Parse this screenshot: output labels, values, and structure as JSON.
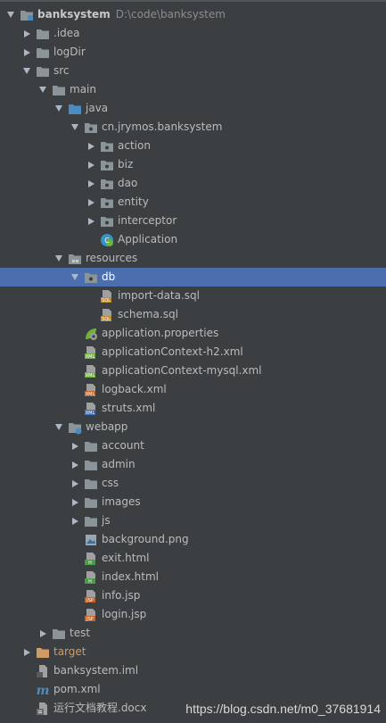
{
  "project": {
    "name": "banksystem",
    "path": "D:\\code\\banksystem"
  },
  "tree": [
    {
      "id": "banksystem",
      "label": "banksystem",
      "depth": 0,
      "arrow": "down",
      "icon": "module-folder-icon",
      "bold": true,
      "path": "D:\\code\\banksystem"
    },
    {
      "id": "idea",
      "label": ".idea",
      "depth": 1,
      "arrow": "right",
      "icon": "folder-icon"
    },
    {
      "id": "logdir",
      "label": "logDir",
      "depth": 1,
      "arrow": "right",
      "icon": "folder-icon"
    },
    {
      "id": "src",
      "label": "src",
      "depth": 1,
      "arrow": "down",
      "icon": "folder-icon"
    },
    {
      "id": "main",
      "label": "main",
      "depth": 2,
      "arrow": "down",
      "icon": "folder-icon"
    },
    {
      "id": "java",
      "label": "java",
      "depth": 3,
      "arrow": "down",
      "icon": "source-folder-icon"
    },
    {
      "id": "pkg",
      "label": "cn.jrymos.banksystem",
      "depth": 4,
      "arrow": "down",
      "icon": "package-icon"
    },
    {
      "id": "action",
      "label": "action",
      "depth": 5,
      "arrow": "right",
      "icon": "package-icon"
    },
    {
      "id": "biz",
      "label": "biz",
      "depth": 5,
      "arrow": "right",
      "icon": "package-icon"
    },
    {
      "id": "dao",
      "label": "dao",
      "depth": 5,
      "arrow": "right",
      "icon": "package-icon"
    },
    {
      "id": "entity",
      "label": "entity",
      "depth": 5,
      "arrow": "right",
      "icon": "package-icon"
    },
    {
      "id": "interceptor",
      "label": "interceptor",
      "depth": 5,
      "arrow": "right",
      "icon": "package-icon"
    },
    {
      "id": "application",
      "label": "Application",
      "depth": 5,
      "arrow": "none",
      "icon": "spring-boot-class-icon"
    },
    {
      "id": "resources",
      "label": "resources",
      "depth": 3,
      "arrow": "down",
      "icon": "resources-folder-icon"
    },
    {
      "id": "db",
      "label": "db",
      "depth": 4,
      "arrow": "down",
      "icon": "package-icon",
      "selected": true
    },
    {
      "id": "importdata",
      "label": "import-data.sql",
      "depth": 5,
      "arrow": "none",
      "icon": "sql-file-icon"
    },
    {
      "id": "schema",
      "label": "schema.sql",
      "depth": 5,
      "arrow": "none",
      "icon": "sql-file-icon"
    },
    {
      "id": "appprops",
      "label": "application.properties",
      "depth": 4,
      "arrow": "none",
      "icon": "spring-properties-icon"
    },
    {
      "id": "ctxh2",
      "label": "applicationContext-h2.xml",
      "depth": 4,
      "arrow": "none",
      "icon": "spring-xml-icon"
    },
    {
      "id": "ctxmysql",
      "label": "applicationContext-mysql.xml",
      "depth": 4,
      "arrow": "none",
      "icon": "spring-xml-icon"
    },
    {
      "id": "logback",
      "label": "logback.xml",
      "depth": 4,
      "arrow": "none",
      "icon": "xml-file-icon"
    },
    {
      "id": "struts",
      "label": "struts.xml",
      "depth": 4,
      "arrow": "none",
      "icon": "struts-xml-icon"
    },
    {
      "id": "webapp",
      "label": "webapp",
      "depth": 3,
      "arrow": "down",
      "icon": "web-folder-icon"
    },
    {
      "id": "account",
      "label": "account",
      "depth": 4,
      "arrow": "right",
      "icon": "folder-icon"
    },
    {
      "id": "admin",
      "label": "admin",
      "depth": 4,
      "arrow": "right",
      "icon": "folder-icon"
    },
    {
      "id": "css",
      "label": "css",
      "depth": 4,
      "arrow": "right",
      "icon": "folder-icon"
    },
    {
      "id": "images",
      "label": "images",
      "depth": 4,
      "arrow": "right",
      "icon": "folder-icon"
    },
    {
      "id": "js",
      "label": "js",
      "depth": 4,
      "arrow": "right",
      "icon": "folder-icon"
    },
    {
      "id": "bgpng",
      "label": "background.png",
      "depth": 4,
      "arrow": "none",
      "icon": "image-file-icon"
    },
    {
      "id": "exithtml",
      "label": "exit.html",
      "depth": 4,
      "arrow": "none",
      "icon": "html-file-icon"
    },
    {
      "id": "indexhtml",
      "label": "index.html",
      "depth": 4,
      "arrow": "none",
      "icon": "html-file-icon"
    },
    {
      "id": "infojsp",
      "label": "info.jsp",
      "depth": 4,
      "arrow": "none",
      "icon": "jsp-file-icon"
    },
    {
      "id": "loginjsp",
      "label": "login.jsp",
      "depth": 4,
      "arrow": "none",
      "icon": "jsp-file-icon"
    },
    {
      "id": "test",
      "label": "test",
      "depth": 2,
      "arrow": "right",
      "icon": "folder-icon"
    },
    {
      "id": "target",
      "label": "target",
      "depth": 1,
      "arrow": "right",
      "icon": "excluded-folder-icon",
      "orange": true
    },
    {
      "id": "iml",
      "label": "banksystem.iml",
      "depth": 1,
      "arrow": "none",
      "icon": "iml-file-icon"
    },
    {
      "id": "pom",
      "label": "pom.xml",
      "depth": 1,
      "arrow": "none",
      "icon": "maven-icon"
    },
    {
      "id": "docx",
      "label": "运行文档教程.docx",
      "depth": 1,
      "arrow": "none",
      "icon": "docx-file-icon"
    }
  ],
  "watermark": "https://blog.csdn.net/m0_37681914",
  "colors": {
    "background": "#3c3f41",
    "selection": "#4b6eaf",
    "text": "#bbbbbb",
    "folder": "#8a9499",
    "source_folder": "#4a8cc2",
    "package": "#8a9499",
    "excluded": "#d19a66"
  }
}
